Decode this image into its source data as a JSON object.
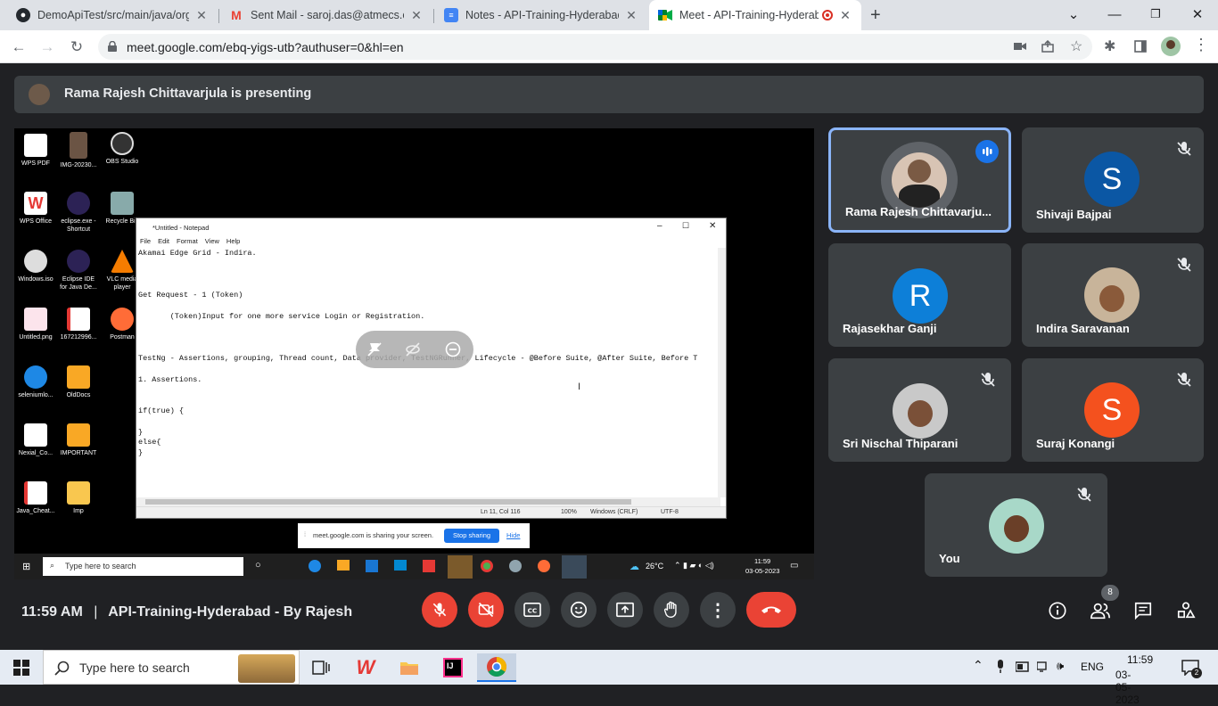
{
  "browser": {
    "tabs": [
      {
        "title": "DemoApiTest/src/main/java/org/",
        "icon": "github-icon"
      },
      {
        "title": "Sent Mail - saroj.das@atmecs.co",
        "icon": "gmail-icon"
      },
      {
        "title": "Notes - API-Training-Hyderabad",
        "icon": "docs-icon"
      },
      {
        "title": "Meet - API-Training-Hyderab",
        "icon": "meet-icon",
        "active": true
      }
    ],
    "url": "meet.google.com/ebq-yigs-utb?authuser=0&hl=en"
  },
  "meet": {
    "presenting_text": "Rama Rajesh Chittavarjula is presenting",
    "participants": [
      {
        "name": "Rama Rajesh Chittavarju...",
        "avatar": "photo",
        "speaking": true
      },
      {
        "name": "Shivaji Bajpai",
        "initial": "S",
        "color": "#0b57a4",
        "muted": true
      },
      {
        "name": "Rajasekhar Ganji",
        "initial": "R",
        "color": "#0d7fd8",
        "muted": false
      },
      {
        "name": "Indira Saravanan",
        "avatar": "photo",
        "muted": true
      },
      {
        "name": "Sri Nischal Thiparani",
        "avatar": "photo",
        "muted": true
      },
      {
        "name": "Suraj Konangi",
        "initial": "S",
        "color": "#f4511e",
        "muted": true
      },
      {
        "name": "You",
        "avatar": "photo",
        "muted": true
      }
    ],
    "time": "11:59 AM",
    "meeting_title": "API-Training-Hyderabad - By Rajesh",
    "people_count": "8"
  },
  "shared_screen": {
    "desktop_icons": [
      "WPS PDF",
      "IMG-20230...",
      "OBS Studio",
      "WPS Office",
      "eclipse.exe - Shortcut",
      "Recycle Bin",
      "Windows.iso",
      "Eclipse IDE for Java De...",
      "VLC media player",
      "Untitled.png",
      "167212996...",
      "Postman",
      "seleniumlo...",
      "OldDocs",
      "Nexial_Co...",
      "IMPORTANT",
      "Java_Cheat...",
      "Imp"
    ],
    "notepad": {
      "title": "*Untitled - Notepad",
      "menu": [
        "File",
        "Edit",
        "Format",
        "View",
        "Help"
      ],
      "lines": [
        "Akamai Edge Grid - Indira.",
        "",
        "",
        "",
        "Get Request - 1 (Token)",
        "",
        "       (Token)Input for one more service Login or Registration.",
        "",
        "",
        "",
        "TestNg - Assertions, grouping, Thread count, Data provider, TestNGRunner, Lifecycle - @Before Suite, @After Suite, Before T",
        "",
        "1. Assertions.",
        "",
        "",
        "if(true) {",
        "",
        "}",
        "else{",
        "}"
      ],
      "status_pos": "Ln 11, Col 116",
      "status_zoom": "100%",
      "status_eol": "Windows (CRLF)",
      "status_enc": "UTF-8"
    },
    "share_notice": "meet.google.com is sharing your screen.",
    "stop_sharing": "Stop sharing",
    "hide": "Hide",
    "taskbar_search": "Type here to search",
    "weather": "26°C",
    "clock_time": "11:59",
    "clock_date": "03-05-2023"
  },
  "taskbar": {
    "search_placeholder": "Type here to search",
    "lang": "ENG",
    "time": "11:59",
    "date": "03-05-2023",
    "notifications": "2"
  }
}
